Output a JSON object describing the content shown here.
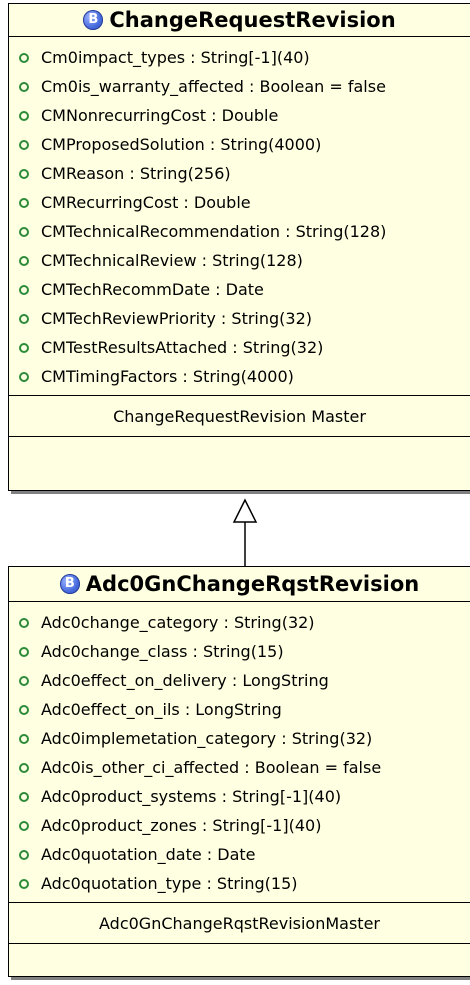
{
  "classes": [
    {
      "stereotype_badge": "B",
      "name": "ChangeRequestRevision",
      "attributes": [
        "Cm0impact_types : String[-1](40)",
        "Cm0is_warranty_affected : Boolean = false",
        "CMNonrecurringCost : Double",
        "CMProposedSolution : String(4000)",
        "CMReason : String(256)",
        "CMRecurringCost : Double",
        "CMTechnicalRecommendation : String(128)",
        "CMTechnicalReview : String(128)",
        "CMTechRecommDate : Date",
        "CMTechReviewPriority : String(32)",
        "CMTestResultsAttached : String(32)",
        "CMTimingFactors : String(4000)"
      ],
      "master": "ChangeRequestRevision Master"
    },
    {
      "stereotype_badge": "B",
      "name": "Adc0GnChangeRqstRevision",
      "attributes": [
        "Adc0change_category : String(32)",
        "Adc0change_class : String(15)",
        "Adc0effect_on_delivery : LongString",
        "Adc0effect_on_ils : LongString",
        "Adc0implemetation_category : String(32)",
        "Adc0is_other_ci_affected : Boolean = false",
        "Adc0product_systems : String[-1](40)",
        "Adc0product_zones : String[-1](40)",
        "Adc0quotation_date : Date",
        "Adc0quotation_type : String(15)"
      ],
      "master": "Adc0GnChangeRqstRevisionMaster"
    }
  ],
  "relationship": {
    "type": "generalization",
    "from": "Adc0GnChangeRqstRevision",
    "to": "ChangeRequestRevision"
  },
  "colors": {
    "class_fill": "#ffffe1",
    "badge_blue": "#4a6ee0",
    "attribute_marker": "#2e8b3a",
    "border": "#000000"
  }
}
